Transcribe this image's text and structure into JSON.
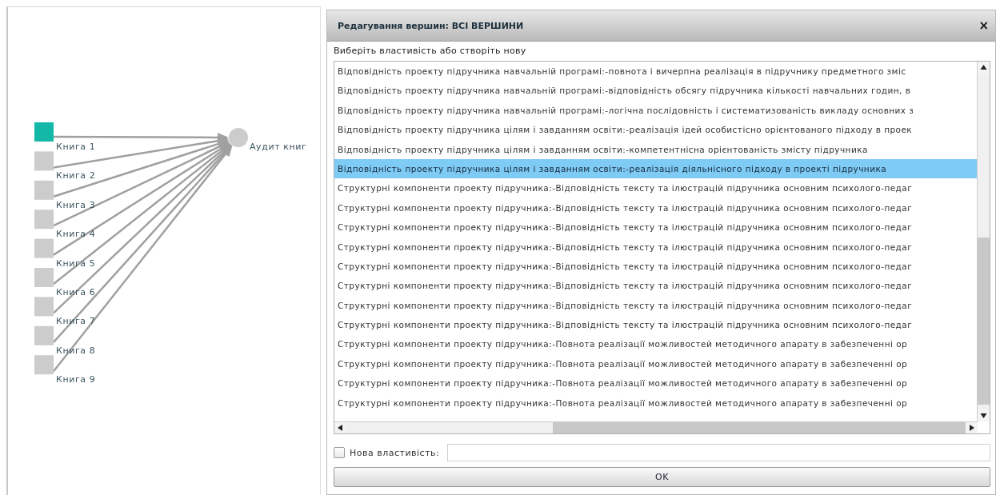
{
  "graph": {
    "nodes": [
      {
        "label": "Книга 1",
        "selected": true
      },
      {
        "label": "Книга 2",
        "selected": false
      },
      {
        "label": "Книга 3",
        "selected": false
      },
      {
        "label": "Книга 4",
        "selected": false
      },
      {
        "label": "Книга 5",
        "selected": false
      },
      {
        "label": "Книга 6",
        "selected": false
      },
      {
        "label": "Книга 7",
        "selected": false
      },
      {
        "label": "Книга 8",
        "selected": false
      },
      {
        "label": "Книга 9",
        "selected": false
      }
    ],
    "target": {
      "label": "Аудит книг"
    }
  },
  "dialog": {
    "title": "Редагування вершин: ВСІ ВЕРШИНИ",
    "close": "×",
    "prompt": "Виберіть властивість або створіть нову",
    "properties": [
      {
        "text": "Відповідність проекту підручника навчальній програмі:-повнота і вичерпна реалізація в підручнику предметного зміс",
        "selected": false
      },
      {
        "text": "Відповідність проекту підручника навчальній програмі:-відповідність обсягу підручника кількості навчальних годин, в",
        "selected": false
      },
      {
        "text": "Відповідність проекту підручника навчальній програмі:-логічна послідовність і систематизованість викладу основних з",
        "selected": false
      },
      {
        "text": "Відповідність проекту підручника цілям і завданням освіти:-реалізація ідей особистісно орієнтованого підходу в проек",
        "selected": false
      },
      {
        "text": "Відповідність проекту підручника цілям і завданням освіти:-компетентнісна орієнтованість змісту підручника",
        "selected": false
      },
      {
        "text": "Відповідність проекту підручника цілям і завданням освіти:-реалізація діяльнісного підходу в проекті підручника",
        "selected": true
      },
      {
        "text": "Структурні компоненти проекту підручника:-Відповідність тексту та ілюстрацій підручника основним психолого-педаг",
        "selected": false
      },
      {
        "text": "Структурні компоненти проекту підручника:-Відповідність тексту та ілюстрацій підручника основним психолого-педаг",
        "selected": false
      },
      {
        "text": "Структурні компоненти проекту підручника:-Відповідність тексту та ілюстрацій підручника основним психолого-педаг",
        "selected": false
      },
      {
        "text": "Структурні компоненти проекту підручника:-Відповідність тексту та ілюстрацій підручника основним психолого-педаг",
        "selected": false
      },
      {
        "text": "Структурні компоненти проекту підручника:-Відповідність тексту та ілюстрацій підручника основним психолого-педаг",
        "selected": false
      },
      {
        "text": "Структурні компоненти проекту підручника:-Відповідність тексту та ілюстрацій підручника основним психолого-педаг",
        "selected": false
      },
      {
        "text": "Структурні компоненти проекту підручника:-Відповідність тексту та ілюстрацій підручника основним психолого-педаг",
        "selected": false
      },
      {
        "text": "Структурні компоненти проекту підручника:-Відповідність тексту та ілюстрацій підручника основним психолого-педаг",
        "selected": false
      },
      {
        "text": "Структурні компоненти проекту підручника:-Повнота реалізації можливостей методичного апарату в забезпеченні ор",
        "selected": false
      },
      {
        "text": "Структурні компоненти проекту підручника:-Повнота реалізації можливостей методичного апарату в забезпеченні ор",
        "selected": false
      },
      {
        "text": "Структурні компоненти проекту підручника:-Повнота реалізації можливостей методичного апарату в забезпеченні ор",
        "selected": false
      },
      {
        "text": "Структурні компоненти проекту підручника:-Повнота реалізації можливостей методичного апарату в забезпеченні ор",
        "selected": false
      }
    ],
    "new_property": {
      "label": "Нова властивість:",
      "checked": false
    },
    "ok": "OK"
  }
}
